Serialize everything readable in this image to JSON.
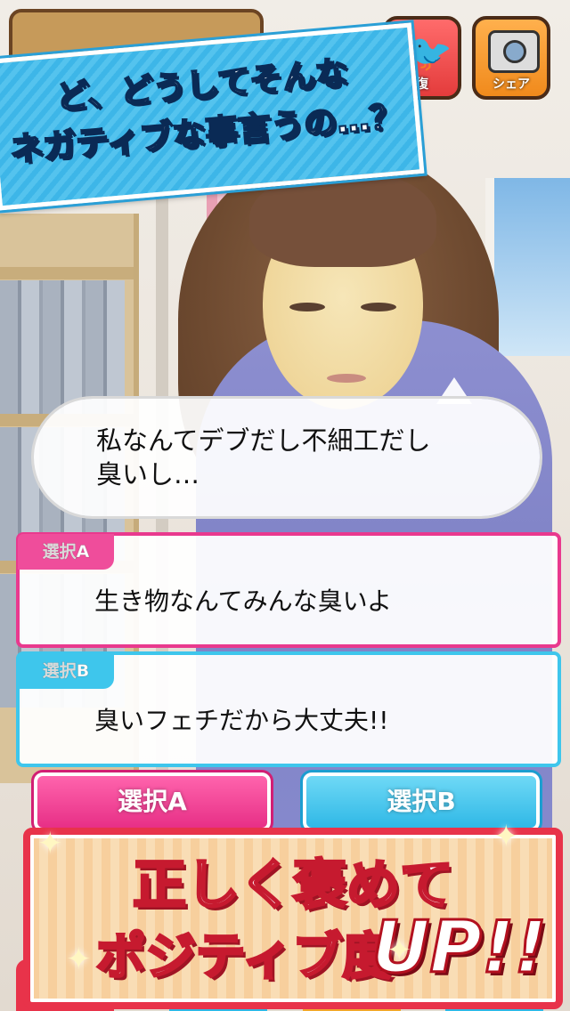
{
  "top_buttons": {
    "twitter_label": "復",
    "share_label": "シェア"
  },
  "headline": {
    "line1": "ど、どうしてそんな",
    "line2": "ネガティブな事言うの…？"
  },
  "speech": {
    "line1": "私なんてデブだし不細工だし",
    "line2": "臭いし…"
  },
  "choices": [
    {
      "tag": "選択A",
      "text": "生き物なんてみんな臭いよ"
    },
    {
      "tag": "選択B",
      "text": "臭いフェチだから大丈夫!!"
    }
  ],
  "answer_buttons": {
    "a_label": "選択A",
    "b_label": "選択B"
  },
  "promo": {
    "line1": "正しく褒めて",
    "line2": "ポジティブ度",
    "up": "UP!!"
  },
  "colors": {
    "choice_a": "#e9398e",
    "choice_b": "#3ec6ec",
    "banner": "#3db6e8",
    "promo_border": "#e8334a"
  },
  "icons": [
    "camera-icon",
    "twitter-bird-icon",
    "sparkle-icon"
  ]
}
